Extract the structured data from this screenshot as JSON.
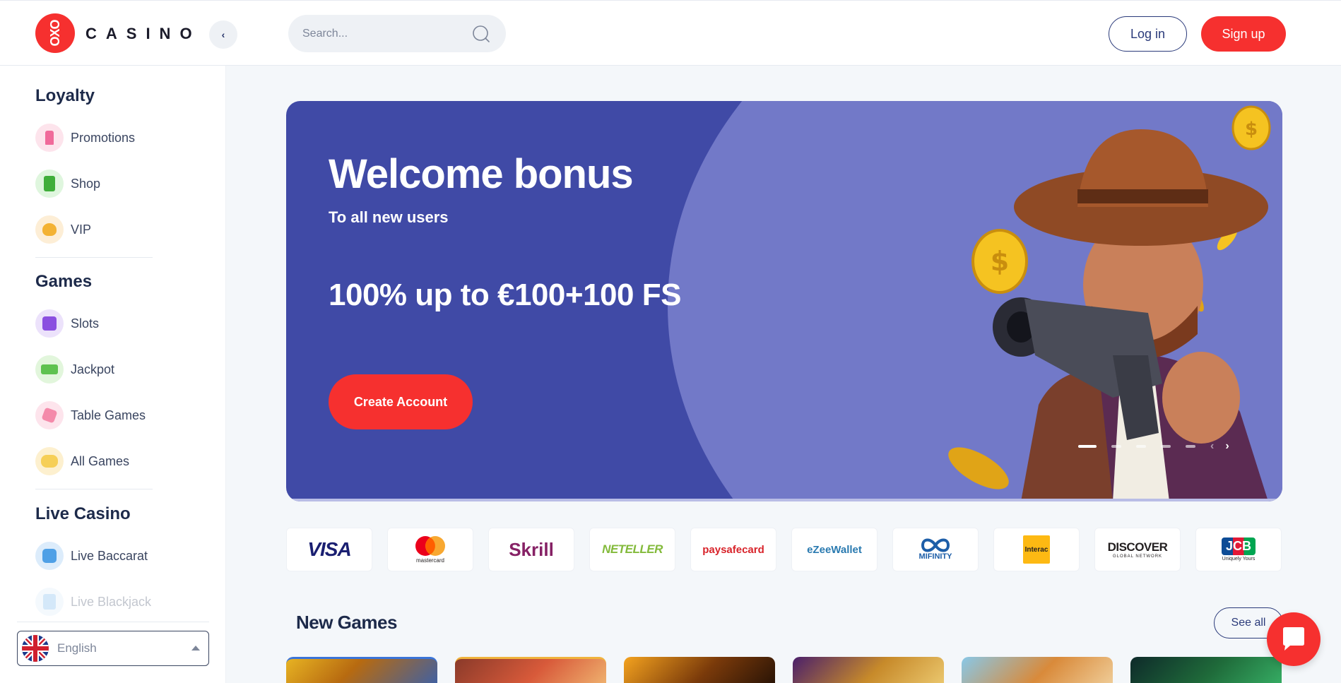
{
  "header": {
    "logo_mark": "OXO",
    "logo_text": "CASINO",
    "search_placeholder": "Search...",
    "login_label": "Log in",
    "signup_label": "Sign up"
  },
  "sidebar": {
    "sections": [
      {
        "title": "Loyalty",
        "items": [
          {
            "label": "Promotions",
            "icon": "promotions-icon"
          },
          {
            "label": "Shop",
            "icon": "shop-icon"
          },
          {
            "label": "VIP",
            "icon": "vip-icon"
          }
        ]
      },
      {
        "title": "Games",
        "items": [
          {
            "label": "Slots",
            "icon": "slots-icon"
          },
          {
            "label": "Jackpot",
            "icon": "jackpot-icon"
          },
          {
            "label": "Table Games",
            "icon": "table-games-icon"
          },
          {
            "label": "All Games",
            "icon": "all-games-icon"
          }
        ]
      },
      {
        "title": "Live Casino",
        "items": [
          {
            "label": "Live Baccarat",
            "icon": "live-baccarat-icon"
          },
          {
            "label": "Live Blackjack",
            "icon": "live-blackjack-icon"
          }
        ]
      }
    ],
    "language": {
      "label": "English",
      "flag": "uk-flag-icon"
    }
  },
  "hero": {
    "title": "Welcome bonus",
    "subtitle": "To all new users",
    "offer": "100% up to €100+100 FS",
    "cta_label": "Create Account",
    "slides_count": 5,
    "active_slide": 1
  },
  "payments": [
    {
      "name": "VISA",
      "color": "#1a1f71"
    },
    {
      "name": "mastercard",
      "color": "#eb001b"
    },
    {
      "name": "Skrill",
      "color": "#862165"
    },
    {
      "name": "NETELLER",
      "color": "#83ba3b"
    },
    {
      "name": "paysafecard",
      "color": "#d8232a"
    },
    {
      "name": "eZeeWallet",
      "color": "#2a7ab0"
    },
    {
      "name": "MIFINITY",
      "color": "#1d5ea8"
    },
    {
      "name": "Interac",
      "color": "#fdb913"
    },
    {
      "name": "DISCOVER",
      "color": "#231f20"
    },
    {
      "name": "JCB",
      "color": "#0e4c96"
    }
  ],
  "payment_sub": {
    "discover": "GLOBAL NETWORK",
    "jcb": "Uniquely Yours"
  },
  "new_games": {
    "title": "New Games",
    "see_all_label": "See all"
  },
  "colors": {
    "brand_red": "#f6302f",
    "navy": "#2a3a7a",
    "hero_dark": "#404aa6",
    "hero_light": "#7279c8"
  }
}
